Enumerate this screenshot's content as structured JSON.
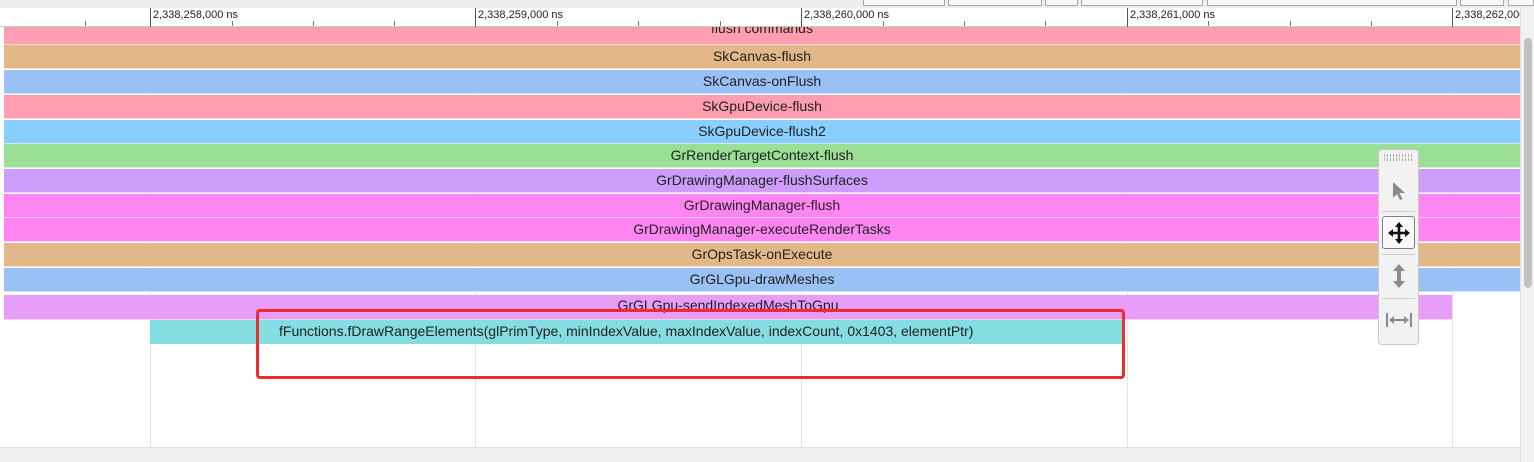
{
  "ruler": {
    "labels": [
      "2,338,258,000 ns",
      "2,338,259,000 ns",
      "2,338,260,000 ns",
      "2,338,261,000 ns",
      "2,338,262,000 ns"
    ]
  },
  "slices": [
    {
      "label": "flush commands",
      "color": "#ff9eb0"
    },
    {
      "label": "SkCanvas-flush",
      "color": "#e3b888"
    },
    {
      "label": "SkCanvas-onFlush",
      "color": "#99c1f5"
    },
    {
      "label": "SkGpuDevice-flush",
      "color": "#ff9eb0"
    },
    {
      "label": "SkGpuDevice-flush2",
      "color": "#88cfff"
    },
    {
      "label": "GrRenderTargetContext-flush",
      "color": "#9adf94"
    },
    {
      "label": "GrDrawingManager-flushSurfaces",
      "color": "#cd9df9"
    },
    {
      "label": "GrDrawingManager-flush",
      "color": "#ff86f2"
    },
    {
      "label": "GrDrawingManager-executeRenderTasks",
      "color": "#ff86f2"
    },
    {
      "label": "GrOpsTask-onExecute",
      "color": "#e3b888"
    },
    {
      "label": "GrGLGpu-drawMeshes",
      "color": "#99c1f5"
    },
    {
      "label": "GrGLGpu-sendIndexedMeshToGpu",
      "color": "#e79df7"
    },
    {
      "label": "fFunctions.fDrawRangeElements(glPrimType, minIndexValue, maxIndexValue, indexCount, 0x1403, elementPtr)",
      "color": "#84dde0"
    }
  ],
  "toolbar": {
    "tools": [
      {
        "name": "select-tool",
        "icon": "arrow-pointer-icon",
        "active": false
      },
      {
        "name": "pan-tool",
        "icon": "move-arrows-icon",
        "active": true
      },
      {
        "name": "zoom-tool",
        "icon": "vertical-arrows-icon",
        "active": false
      },
      {
        "name": "timing-tool",
        "icon": "horizontal-measure-icon",
        "active": false
      }
    ]
  },
  "colors": {
    "highlight": "#ef2b2b",
    "gridline": "#e4e4e4"
  }
}
